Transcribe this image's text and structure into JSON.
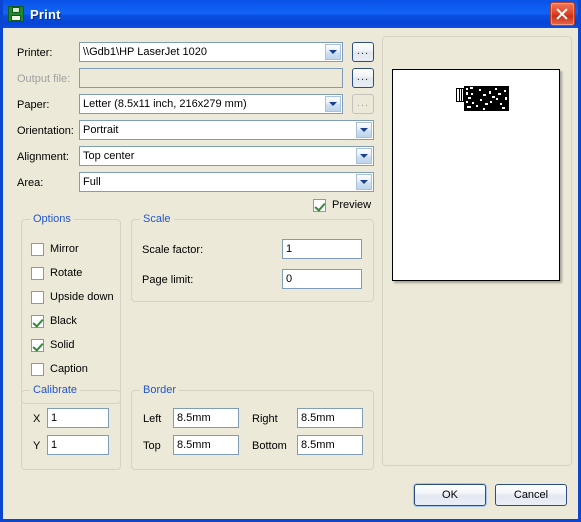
{
  "window": {
    "title": "Print",
    "icon": "printer-floppy-icon",
    "close_label": "Close"
  },
  "form": {
    "printer": {
      "label": "Printer:",
      "value": "\\\\Gdb1\\HP LaserJet 1020",
      "browse_label": "...",
      "disabled": false
    },
    "output_file": {
      "label": "Output file:",
      "value": "",
      "placeholder": "",
      "browse_label": "...",
      "disabled": true
    },
    "paper": {
      "label": "Paper:",
      "value": "Letter (8.5x11 inch, 216x279 mm)",
      "browse_label": "...",
      "browse_disabled": true
    },
    "orientation": {
      "label": "Orientation:",
      "value": "Portrait"
    },
    "alignment": {
      "label": "Alignment:",
      "value": "Top center"
    },
    "area": {
      "label": "Area:",
      "value": "Full"
    },
    "preview_checkbox": {
      "label": "Preview",
      "checked": true
    }
  },
  "options": {
    "legend": "Options",
    "items": [
      {
        "label": "Mirror",
        "checked": false
      },
      {
        "label": "Rotate",
        "checked": false
      },
      {
        "label": "Upside down",
        "checked": false
      },
      {
        "label": "Black",
        "checked": true
      },
      {
        "label": "Solid",
        "checked": true
      },
      {
        "label": "Caption",
        "checked": false
      }
    ]
  },
  "scale": {
    "legend": "Scale",
    "scale_factor": {
      "label": "Scale factor:",
      "value": "1"
    },
    "page_limit": {
      "label": "Page limit:",
      "value": "0"
    }
  },
  "calibrate": {
    "legend": "Calibrate",
    "x": {
      "label": "X",
      "value": "1"
    },
    "y": {
      "label": "Y",
      "value": "1"
    }
  },
  "border": {
    "legend": "Border",
    "left": {
      "label": "Left",
      "value": "8.5mm"
    },
    "right": {
      "label": "Right",
      "value": "8.5mm"
    },
    "top": {
      "label": "Top",
      "value": "8.5mm"
    },
    "bottom": {
      "label": "Bottom",
      "value": "8.5mm"
    }
  },
  "preview": {
    "page_orientation": "portrait",
    "content_alignment": "top center"
  },
  "buttons": {
    "ok": "OK",
    "cancel": "Cancel"
  },
  "colors": {
    "titlebar_blue": "#0A53E8",
    "dialog_face": "#ECE9D8",
    "group_legend_blue": "#2356C8",
    "check_green": "#2E8B33",
    "field_border": "#7F9DB9",
    "close_red": "#E0472A"
  }
}
